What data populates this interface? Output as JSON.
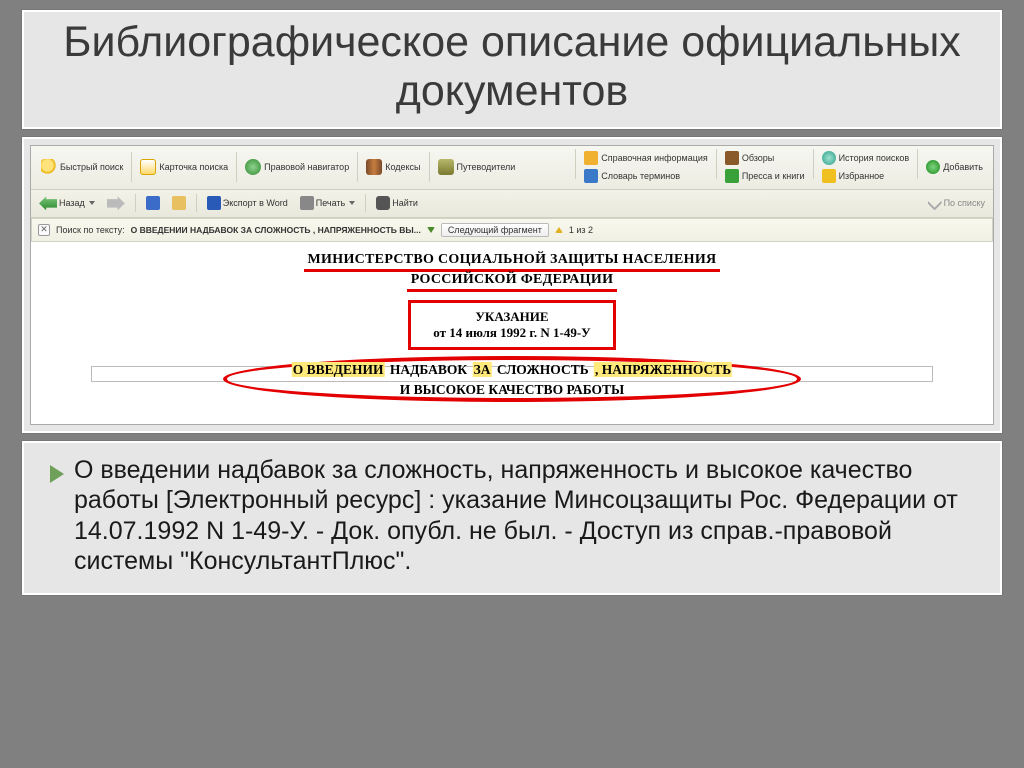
{
  "title": "Библиографическое описание официальных документов",
  "toolbar": {
    "quick_search": "Быстрый поиск",
    "card_search": "Карточка поиска",
    "legal_nav": "Правовой навигатор",
    "codexes": "Кодексы",
    "guides": "Путеводители",
    "ref_info": "Справочная информация",
    "glossary": "Словарь терминов",
    "reviews": "Обзоры",
    "press": "Пресса и книги",
    "search_history": "История поисков",
    "favorites": "Избранное",
    "add": "Добавить"
  },
  "toolbar2": {
    "back": "Назад",
    "export": "Экспорт в Word",
    "print": "Печать",
    "find": "Найти",
    "by_list": "По списку"
  },
  "searchbar": {
    "label": "Поиск по тексту:",
    "query": "О ВВЕДЕНИИ НАДБАВОК ЗА СЛОЖНОСТЬ , НАПРЯЖЕННОСТЬ ВЫ...",
    "next_fragment": "Следующий фрагмент",
    "counter": "1 из 2"
  },
  "document": {
    "ministry_line1": "МИНИСТЕРСТВО СОЦИАЛЬНОЙ ЗАЩИТЫ НАСЕЛЕНИЯ",
    "ministry_line2": "РОССИЙСКОЙ ФЕДЕРАЦИИ",
    "doc_type": "УКАЗАНИЕ",
    "doc_date": "от 14 июля 1992 г. N 1-49-У",
    "subject_p1a": "О ВВЕДЕНИИ",
    "subject_p1b": "НАДБАВОК",
    "subject_p1c": "ЗА",
    "subject_p1d": "СЛОЖНОСТЬ",
    "subject_p1e": ", НАПРЯЖЕННОСТЬ",
    "subject_p2": "И ВЫСОКОЕ КАЧЕСТВО РАБОТЫ"
  },
  "citation": "О введении надбавок за сложность, напряженность и высокое качество работы [Электронный ресурс] : указание Минсоцзащиты Рос. Федерации от 14.07.1992 N 1-49-У. - Док. опубл. не был. - Доступ из справ.-правовой системы \"КонсультантПлюс\"."
}
